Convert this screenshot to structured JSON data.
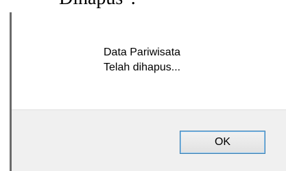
{
  "background_text": "Dihapus\".",
  "dialog": {
    "message_lines": [
      "Data Pariwisata",
      "Telah dihapus..."
    ],
    "ok_label": "OK"
  }
}
